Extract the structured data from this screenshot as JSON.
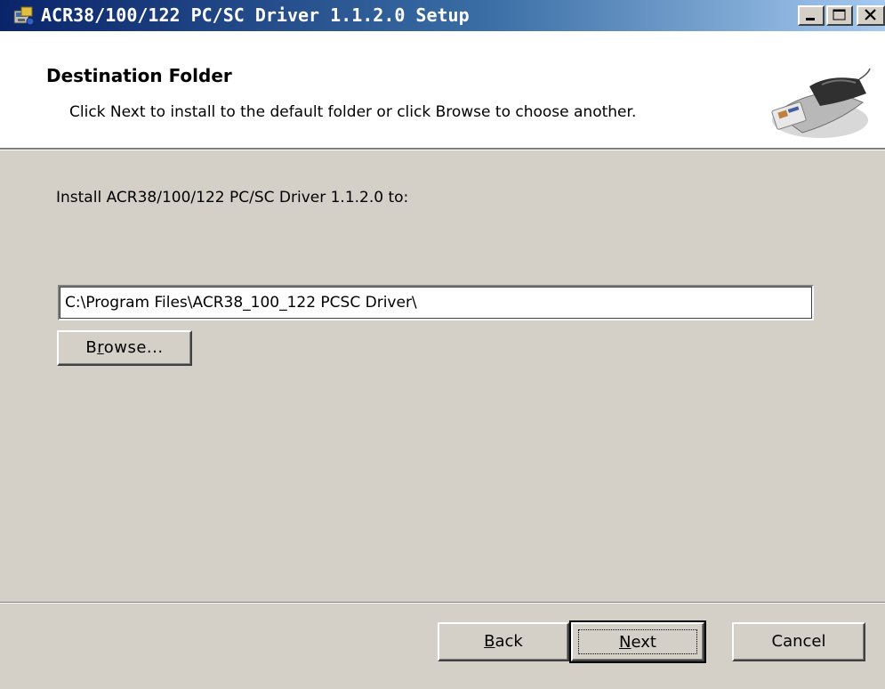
{
  "window": {
    "title": "ACR38/100/122 PC/SC Driver 1.1.2.0 Setup",
    "app_icon": "installer-icon",
    "controls": [
      "minimize-icon",
      "maximize-icon",
      "close-icon"
    ]
  },
  "header": {
    "title": "Destination Folder",
    "subtitle": "Click Next to install to the default folder or click Browse to choose another.",
    "graphic": "card-reader-icon"
  },
  "main": {
    "install_label": "Install ACR38/100/122 PC/SC Driver 1.1.2.0 to:",
    "path_value": "C:\\Program Files\\ACR38_100_122 PCSC Driver\\",
    "browse": {
      "pre": "B",
      "accel": "r",
      "post": "owse..."
    }
  },
  "footer": {
    "back": {
      "accel": "B",
      "post": "ack"
    },
    "next": {
      "accel": "N",
      "post": "ext"
    },
    "cancel": "Cancel"
  },
  "colors": {
    "dialog_bg": "#d4d0c8",
    "title_gradient_start": "#0a246a",
    "title_gradient_end": "#a6caf0",
    "header_bg": "#ffffff"
  }
}
